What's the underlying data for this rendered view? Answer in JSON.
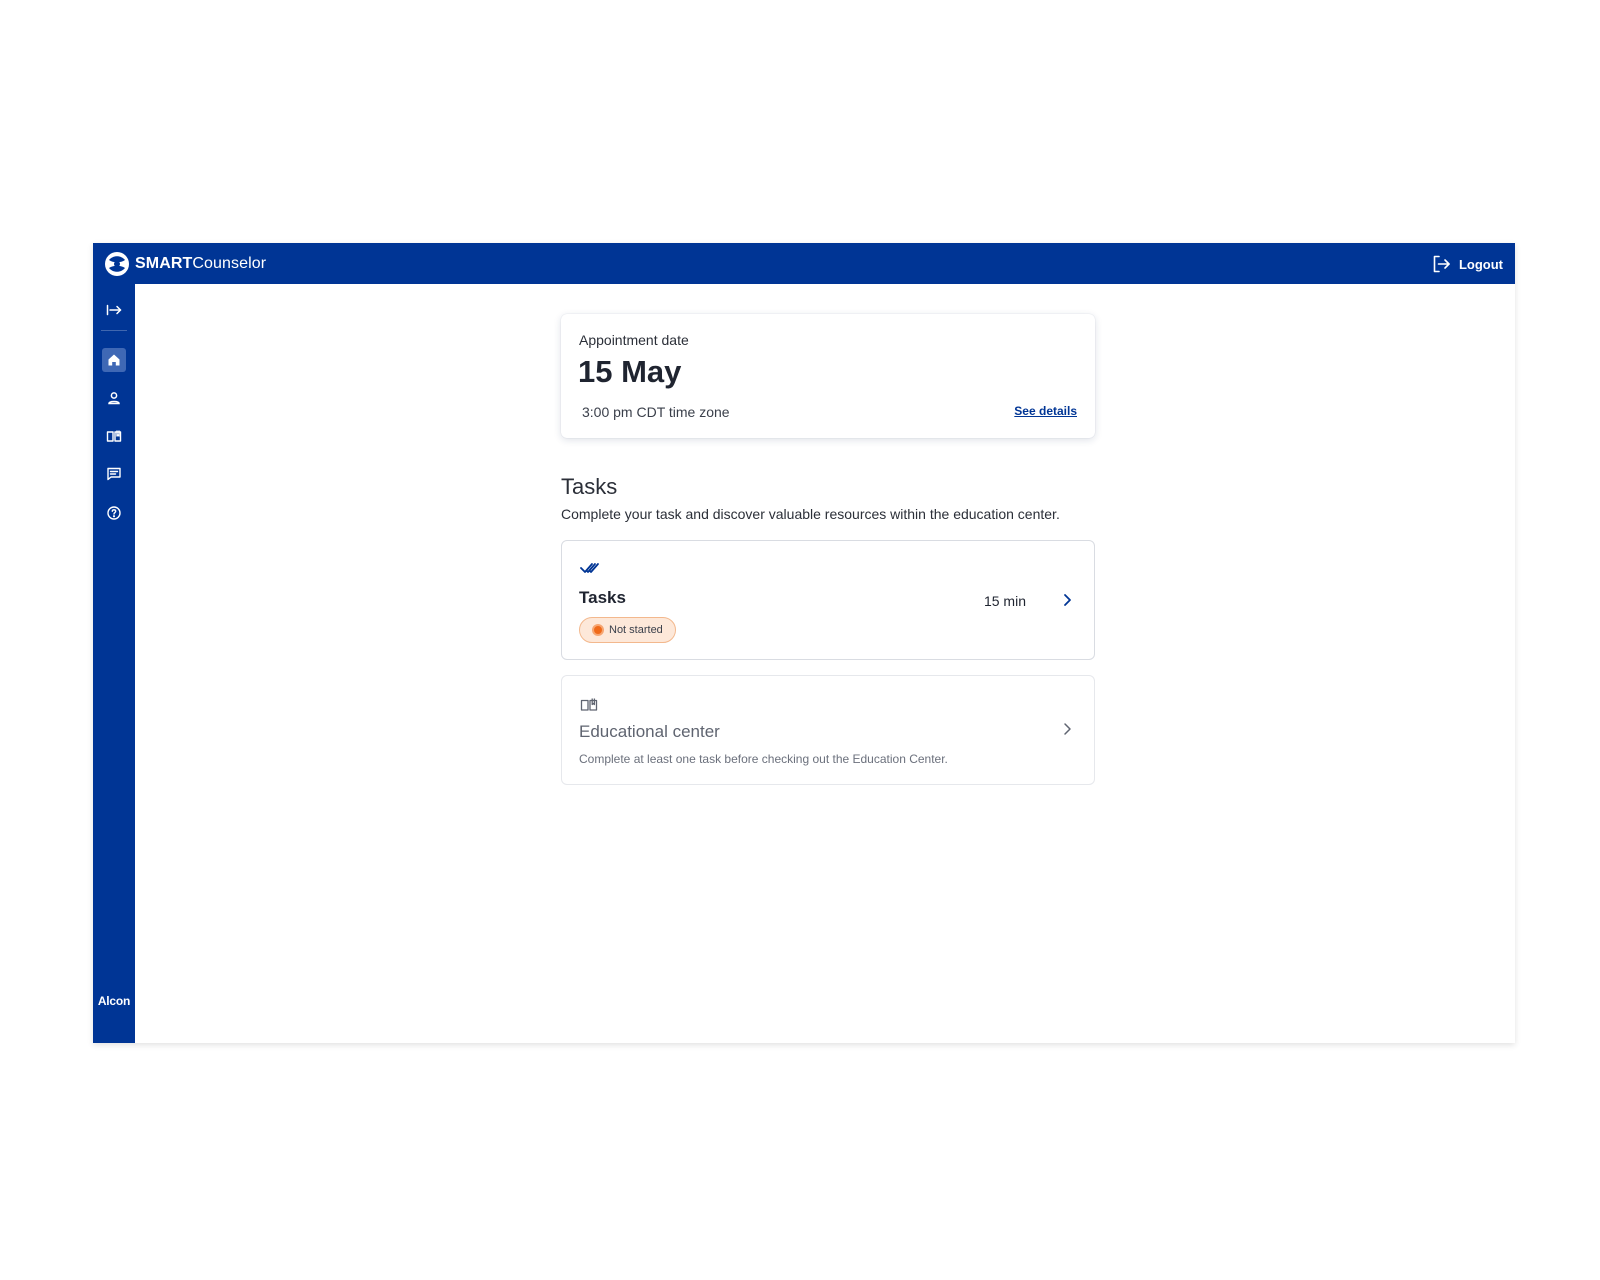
{
  "app": {
    "brand_strong": "SMART",
    "brand_rest": "Counselor",
    "logout_label": "Logout",
    "footer_logo": "Alcon",
    "colors": {
      "primary": "#003595",
      "active_nav": "#3f68b5",
      "status_not_started_bg": "#fde8d9",
      "status_not_started_dot": "#f06a1a"
    }
  },
  "sidebar": {
    "items": [
      {
        "name": "collapse",
        "icon": "expand-arrow-icon",
        "active": false
      },
      {
        "name": "home",
        "icon": "home-icon",
        "active": true
      },
      {
        "name": "profile",
        "icon": "person-icon",
        "active": false
      },
      {
        "name": "education",
        "icon": "book-icon",
        "active": false
      },
      {
        "name": "messages",
        "icon": "chat-icon",
        "active": false
      },
      {
        "name": "help",
        "icon": "help-icon",
        "active": false
      }
    ]
  },
  "appointment": {
    "label": "Appointment date",
    "date": "15 May",
    "time": "3:00 pm CDT time zone",
    "details_link": "See details"
  },
  "tasks_section": {
    "title": "Tasks",
    "subtitle": "Complete your task and discover valuable resources within the education center."
  },
  "task_card": {
    "icon": "double-check-icon",
    "title": "Tasks",
    "status": "Not started",
    "duration": "15 min"
  },
  "education_card": {
    "icon": "book-icon",
    "title": "Educational center",
    "description": "Complete at least one task before checking out the Education Center."
  }
}
